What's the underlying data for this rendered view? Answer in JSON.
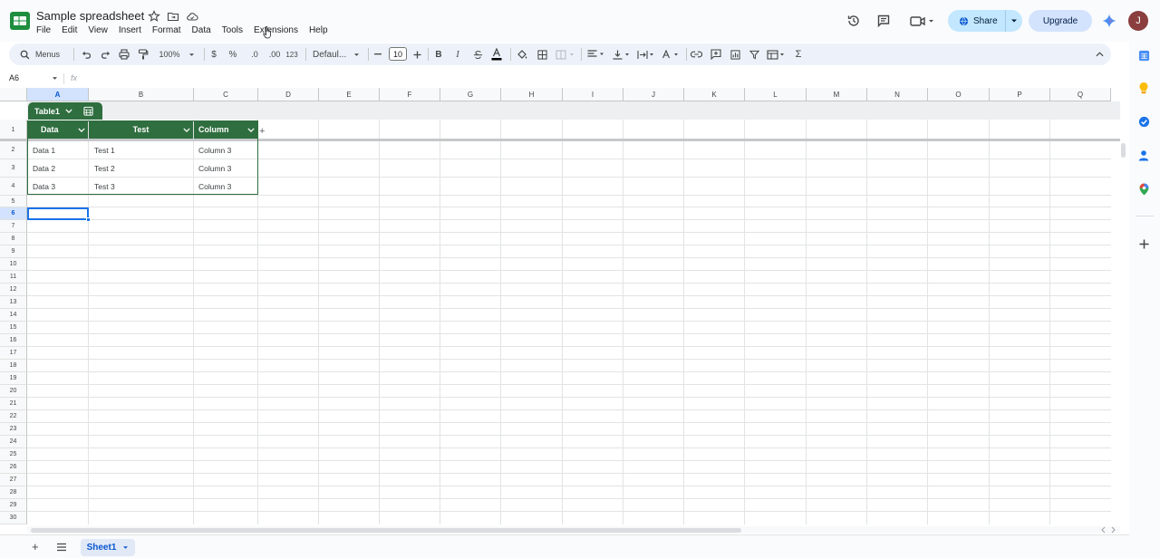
{
  "header": {
    "title": "Sample spreadsheet",
    "menu": [
      "File",
      "Edit",
      "View",
      "Insert",
      "Format",
      "Data",
      "Tools",
      "Extensions",
      "Help"
    ],
    "share_label": "Share",
    "upgrade_label": "Upgrade",
    "avatar_initial": "J"
  },
  "toolbar": {
    "menus_label": "Menus",
    "zoom": "100%",
    "currency": "$",
    "percent": "%",
    "decrease_decimal": ".0",
    "increase_decimal": ".00",
    "number_format": "123",
    "font": "Defaul...",
    "font_size": "10",
    "bold": "B",
    "italic": "I",
    "sigma": "Σ"
  },
  "formula_bar": {
    "name_box": "A6",
    "fx": "fx"
  },
  "grid": {
    "columns": [
      "A",
      "B",
      "C",
      "D",
      "E",
      "F",
      "G",
      "H",
      "I",
      "J",
      "K",
      "L",
      "M",
      "N",
      "O",
      "P",
      "Q"
    ],
    "selected_column": "A",
    "rows": [
      "1",
      "2",
      "3",
      "4",
      "5",
      "6",
      "7",
      "8",
      "9",
      "10",
      "11",
      "12",
      "13",
      "14",
      "15",
      "16",
      "17",
      "18",
      "19",
      "20",
      "21",
      "22",
      "23",
      "24",
      "25",
      "26",
      "27",
      "28",
      "29",
      "30"
    ],
    "selected_row": "6"
  },
  "table": {
    "name": "Table1",
    "headers": [
      "Data",
      "Test",
      "Column"
    ],
    "rows": [
      [
        "Data 1",
        "Test 1",
        "Column 3"
      ],
      [
        "Data 2",
        "Test 2",
        "Column 3"
      ],
      [
        "Data 3",
        "Test 3",
        "Column 3"
      ]
    ],
    "add_column": "+"
  },
  "sheets": {
    "add": "+",
    "active": "Sheet1"
  },
  "colors": {
    "table_header": "#2f6e3f",
    "selection": "#1a73e8",
    "share_bg": "#c2e7ff",
    "upgrade_bg": "#d3e3fd"
  }
}
